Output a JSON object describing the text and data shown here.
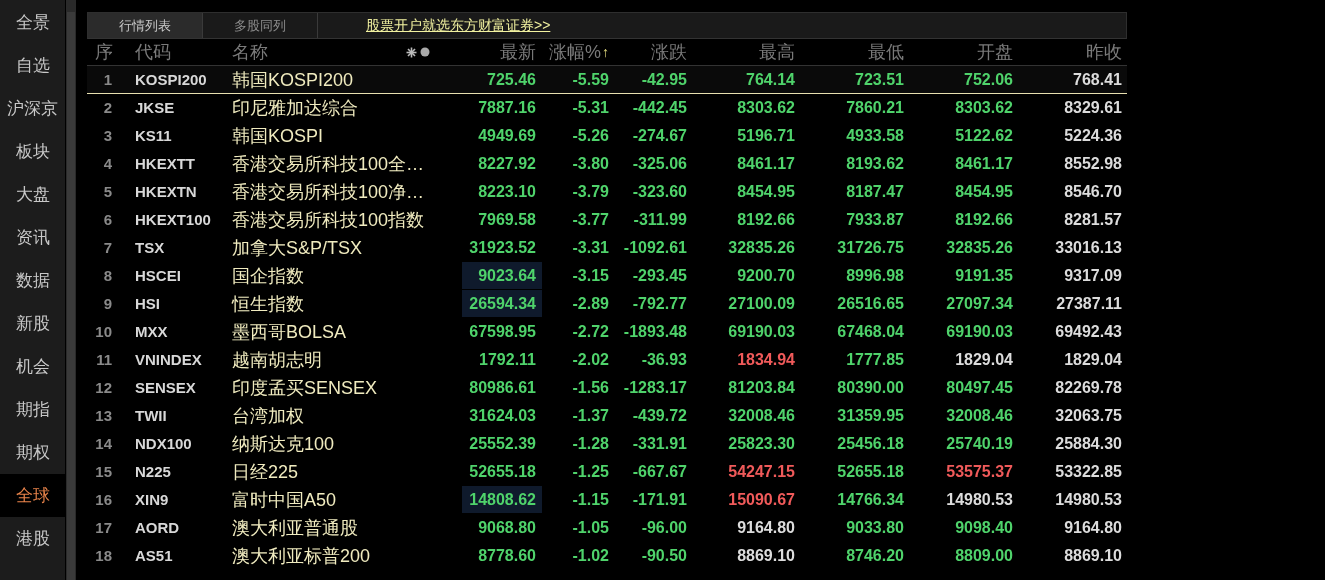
{
  "sidebar": {
    "items": [
      {
        "label": "全景",
        "selected": false
      },
      {
        "label": "自选",
        "selected": false
      },
      {
        "label": "沪深京",
        "selected": false
      },
      {
        "label": "板块",
        "selected": false
      },
      {
        "label": "大盘",
        "selected": false
      },
      {
        "label": "资讯",
        "selected": false
      },
      {
        "label": "数据",
        "selected": false
      },
      {
        "label": "新股",
        "selected": false
      },
      {
        "label": "机会",
        "selected": false
      },
      {
        "label": "期指",
        "selected": false
      },
      {
        "label": "期权",
        "selected": false
      },
      {
        "label": "全球",
        "selected": true
      },
      {
        "label": "港股",
        "selected": false
      }
    ]
  },
  "tabs": [
    {
      "label": "行情列表",
      "selected": true
    },
    {
      "label": "多股同列",
      "selected": false
    }
  ],
  "promo_link": "股票开户就选东方财富证券>>",
  "table": {
    "columns": [
      {
        "label": "序"
      },
      {
        "label": "代码"
      },
      {
        "label": "名称"
      },
      {
        "label": "最新"
      },
      {
        "label": "涨幅%",
        "sort_mark": "↑"
      },
      {
        "label": "涨跌"
      },
      {
        "label": "最高"
      },
      {
        "label": "最低"
      },
      {
        "label": "开盘"
      },
      {
        "label": "昨收"
      }
    ],
    "rows": [
      {
        "index": "1",
        "code": "KOSPI200",
        "name": "韩国KOSPI200",
        "selected": true,
        "values": [
          {
            "text": "725.46",
            "color": "#4fd36b",
            "highlighted": false
          },
          {
            "text": "-5.59",
            "color": "#4fd36b"
          },
          {
            "text": "-42.95",
            "color": "#4fd36b"
          },
          {
            "text": "764.14",
            "color": "#4fd36b"
          },
          {
            "text": "723.51",
            "color": "#4fd36b"
          },
          {
            "text": "752.06",
            "color": "#4fd36b"
          },
          {
            "text": "768.41",
            "color": "#dcdcdc"
          }
        ]
      },
      {
        "index": "2",
        "code": "JKSE",
        "name": "印尼雅加达综合",
        "selected": false,
        "values": [
          {
            "text": "7887.16",
            "color": "#4fd36b",
            "highlighted": false
          },
          {
            "text": "-5.31",
            "color": "#4fd36b"
          },
          {
            "text": "-442.45",
            "color": "#4fd36b"
          },
          {
            "text": "8303.62",
            "color": "#4fd36b"
          },
          {
            "text": "7860.21",
            "color": "#4fd36b"
          },
          {
            "text": "8303.62",
            "color": "#4fd36b"
          },
          {
            "text": "8329.61",
            "color": "#dcdcdc"
          }
        ]
      },
      {
        "index": "3",
        "code": "KS11",
        "name": "韩国KOSPI",
        "selected": false,
        "values": [
          {
            "text": "4949.69",
            "color": "#4fd36b",
            "highlighted": false
          },
          {
            "text": "-5.26",
            "color": "#4fd36b"
          },
          {
            "text": "-274.67",
            "color": "#4fd36b"
          },
          {
            "text": "5196.71",
            "color": "#4fd36b"
          },
          {
            "text": "4933.58",
            "color": "#4fd36b"
          },
          {
            "text": "5122.62",
            "color": "#4fd36b"
          },
          {
            "text": "5224.36",
            "color": "#dcdcdc"
          }
        ]
      },
      {
        "index": "4",
        "code": "HKEXTT",
        "name": "香港交易所科技100全…",
        "selected": false,
        "values": [
          {
            "text": "8227.92",
            "color": "#4fd36b",
            "highlighted": false
          },
          {
            "text": "-3.80",
            "color": "#4fd36b"
          },
          {
            "text": "-325.06",
            "color": "#4fd36b"
          },
          {
            "text": "8461.17",
            "color": "#4fd36b"
          },
          {
            "text": "8193.62",
            "color": "#4fd36b"
          },
          {
            "text": "8461.17",
            "color": "#4fd36b"
          },
          {
            "text": "8552.98",
            "color": "#dcdcdc"
          }
        ]
      },
      {
        "index": "5",
        "code": "HKEXTN",
        "name": "香港交易所科技100净…",
        "selected": false,
        "values": [
          {
            "text": "8223.10",
            "color": "#4fd36b",
            "highlighted": false
          },
          {
            "text": "-3.79",
            "color": "#4fd36b"
          },
          {
            "text": "-323.60",
            "color": "#4fd36b"
          },
          {
            "text": "8454.95",
            "color": "#4fd36b"
          },
          {
            "text": "8187.47",
            "color": "#4fd36b"
          },
          {
            "text": "8454.95",
            "color": "#4fd36b"
          },
          {
            "text": "8546.70",
            "color": "#dcdcdc"
          }
        ]
      },
      {
        "index": "6",
        "code": "HKEXT100",
        "name": "香港交易所科技100指数",
        "selected": false,
        "values": [
          {
            "text": "7969.58",
            "color": "#4fd36b",
            "highlighted": false
          },
          {
            "text": "-3.77",
            "color": "#4fd36b"
          },
          {
            "text": "-311.99",
            "color": "#4fd36b"
          },
          {
            "text": "8192.66",
            "color": "#4fd36b"
          },
          {
            "text": "7933.87",
            "color": "#4fd36b"
          },
          {
            "text": "8192.66",
            "color": "#4fd36b"
          },
          {
            "text": "8281.57",
            "color": "#dcdcdc"
          }
        ]
      },
      {
        "index": "7",
        "code": "TSX",
        "name": "加拿大S&P/TSX",
        "selected": false,
        "values": [
          {
            "text": "31923.52",
            "color": "#4fd36b",
            "highlighted": false
          },
          {
            "text": "-3.31",
            "color": "#4fd36b"
          },
          {
            "text": "-1092.61",
            "color": "#4fd36b"
          },
          {
            "text": "32835.26",
            "color": "#4fd36b"
          },
          {
            "text": "31726.75",
            "color": "#4fd36b"
          },
          {
            "text": "32835.26",
            "color": "#4fd36b"
          },
          {
            "text": "33016.13",
            "color": "#dcdcdc"
          }
        ]
      },
      {
        "index": "8",
        "code": "HSCEI",
        "name": "国企指数",
        "selected": false,
        "values": [
          {
            "text": "9023.64",
            "color": "#4fd36b",
            "highlighted": true
          },
          {
            "text": "-3.15",
            "color": "#4fd36b"
          },
          {
            "text": "-293.45",
            "color": "#4fd36b"
          },
          {
            "text": "9200.70",
            "color": "#4fd36b"
          },
          {
            "text": "8996.98",
            "color": "#4fd36b"
          },
          {
            "text": "9191.35",
            "color": "#4fd36b"
          },
          {
            "text": "9317.09",
            "color": "#dcdcdc"
          }
        ]
      },
      {
        "index": "9",
        "code": "HSI",
        "name": "恒生指数",
        "selected": false,
        "values": [
          {
            "text": "26594.34",
            "color": "#4fd36b",
            "highlighted": true
          },
          {
            "text": "-2.89",
            "color": "#4fd36b"
          },
          {
            "text": "-792.77",
            "color": "#4fd36b"
          },
          {
            "text": "27100.09",
            "color": "#4fd36b"
          },
          {
            "text": "26516.65",
            "color": "#4fd36b"
          },
          {
            "text": "27097.34",
            "color": "#4fd36b"
          },
          {
            "text": "27387.11",
            "color": "#dcdcdc"
          }
        ]
      },
      {
        "index": "10",
        "code": "MXX",
        "name": "墨西哥BOLSA",
        "selected": false,
        "values": [
          {
            "text": "67598.95",
            "color": "#4fd36b",
            "highlighted": false
          },
          {
            "text": "-2.72",
            "color": "#4fd36b"
          },
          {
            "text": "-1893.48",
            "color": "#4fd36b"
          },
          {
            "text": "69190.03",
            "color": "#4fd36b"
          },
          {
            "text": "67468.04",
            "color": "#4fd36b"
          },
          {
            "text": "69190.03",
            "color": "#4fd36b"
          },
          {
            "text": "69492.43",
            "color": "#dcdcdc"
          }
        ]
      },
      {
        "index": "11",
        "code": "VNINDEX",
        "name": "越南胡志明",
        "selected": false,
        "values": [
          {
            "text": "1792.11",
            "color": "#4fd36b",
            "highlighted": false
          },
          {
            "text": "-2.02",
            "color": "#4fd36b"
          },
          {
            "text": "-36.93",
            "color": "#4fd36b"
          },
          {
            "text": "1834.94",
            "color": "#f05a5a"
          },
          {
            "text": "1777.85",
            "color": "#4fd36b"
          },
          {
            "text": "1829.04",
            "color": "#dcdcdc"
          },
          {
            "text": "1829.04",
            "color": "#dcdcdc"
          }
        ]
      },
      {
        "index": "12",
        "code": "SENSEX",
        "name": "印度孟买SENSEX",
        "selected": false,
        "values": [
          {
            "text": "80986.61",
            "color": "#4fd36b",
            "highlighted": false
          },
          {
            "text": "-1.56",
            "color": "#4fd36b"
          },
          {
            "text": "-1283.17",
            "color": "#4fd36b"
          },
          {
            "text": "81203.84",
            "color": "#4fd36b"
          },
          {
            "text": "80390.00",
            "color": "#4fd36b"
          },
          {
            "text": "80497.45",
            "color": "#4fd36b"
          },
          {
            "text": "82269.78",
            "color": "#dcdcdc"
          }
        ]
      },
      {
        "index": "13",
        "code": "TWII",
        "name": "台湾加权",
        "selected": false,
        "values": [
          {
            "text": "31624.03",
            "color": "#4fd36b",
            "highlighted": false
          },
          {
            "text": "-1.37",
            "color": "#4fd36b"
          },
          {
            "text": "-439.72",
            "color": "#4fd36b"
          },
          {
            "text": "32008.46",
            "color": "#4fd36b"
          },
          {
            "text": "31359.95",
            "color": "#4fd36b"
          },
          {
            "text": "32008.46",
            "color": "#4fd36b"
          },
          {
            "text": "32063.75",
            "color": "#dcdcdc"
          }
        ]
      },
      {
        "index": "14",
        "code": "NDX100",
        "name": "纳斯达克100",
        "selected": false,
        "values": [
          {
            "text": "25552.39",
            "color": "#4fd36b",
            "highlighted": false
          },
          {
            "text": "-1.28",
            "color": "#4fd36b"
          },
          {
            "text": "-331.91",
            "color": "#4fd36b"
          },
          {
            "text": "25823.30",
            "color": "#4fd36b"
          },
          {
            "text": "25456.18",
            "color": "#4fd36b"
          },
          {
            "text": "25740.19",
            "color": "#4fd36b"
          },
          {
            "text": "25884.30",
            "color": "#dcdcdc"
          }
        ]
      },
      {
        "index": "15",
        "code": "N225",
        "name": "日经225",
        "selected": false,
        "values": [
          {
            "text": "52655.18",
            "color": "#4fd36b",
            "highlighted": false
          },
          {
            "text": "-1.25",
            "color": "#4fd36b"
          },
          {
            "text": "-667.67",
            "color": "#4fd36b"
          },
          {
            "text": "54247.15",
            "color": "#f05a5a"
          },
          {
            "text": "52655.18",
            "color": "#4fd36b"
          },
          {
            "text": "53575.37",
            "color": "#f05a5a"
          },
          {
            "text": "53322.85",
            "color": "#dcdcdc"
          }
        ]
      },
      {
        "index": "16",
        "code": "XIN9",
        "name": "富时中国A50",
        "selected": false,
        "values": [
          {
            "text": "14808.62",
            "color": "#4fd36b",
            "highlighted": true
          },
          {
            "text": "-1.15",
            "color": "#4fd36b"
          },
          {
            "text": "-171.91",
            "color": "#4fd36b"
          },
          {
            "text": "15090.67",
            "color": "#f05a5a"
          },
          {
            "text": "14766.34",
            "color": "#4fd36b"
          },
          {
            "text": "14980.53",
            "color": "#dcdcdc"
          },
          {
            "text": "14980.53",
            "color": "#dcdcdc"
          }
        ]
      },
      {
        "index": "17",
        "code": "AORD",
        "name": "澳大利亚普通股",
        "selected": false,
        "values": [
          {
            "text": "9068.80",
            "color": "#4fd36b",
            "highlighted": false
          },
          {
            "text": "-1.05",
            "color": "#4fd36b"
          },
          {
            "text": "-96.00",
            "color": "#4fd36b"
          },
          {
            "text": "9164.80",
            "color": "#dcdcdc"
          },
          {
            "text": "9033.80",
            "color": "#4fd36b"
          },
          {
            "text": "9098.40",
            "color": "#4fd36b"
          },
          {
            "text": "9164.80",
            "color": "#dcdcdc"
          }
        ]
      },
      {
        "index": "18",
        "code": "AS51",
        "name": "澳大利亚标普200",
        "selected": false,
        "values": [
          {
            "text": "8778.60",
            "color": "#4fd36b",
            "highlighted": false
          },
          {
            "text": "-1.02",
            "color": "#4fd36b"
          },
          {
            "text": "-90.50",
            "color": "#4fd36b"
          },
          {
            "text": "8869.10",
            "color": "#dcdcdc"
          },
          {
            "text": "8746.20",
            "color": "#4fd36b"
          },
          {
            "text": "8809.00",
            "color": "#4fd36b"
          },
          {
            "text": "8869.10",
            "color": "#dcdcdc"
          }
        ]
      }
    ]
  }
}
